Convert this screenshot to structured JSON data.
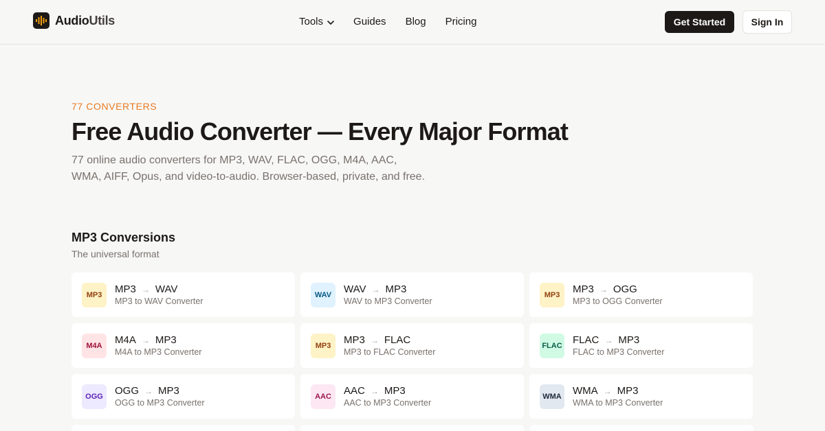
{
  "nav": {
    "logo_primary": "Audio",
    "logo_secondary": "Utils",
    "menu": [
      "Tools",
      "Guides",
      "Blog",
      "Pricing"
    ],
    "get_started": "Get Started",
    "sign_in": "Sign In"
  },
  "hero": {
    "eyebrow": "77 CONVERTERS",
    "title": "Free Audio Converter — Every Major Format",
    "lede": "77 online audio converters for MP3, WAV, FLAC, OGG, M4A, AAC, WMA, AIFF, Opus, and video-to-audio. Browser-based, private, and free."
  },
  "section": {
    "title": "MP3 Conversions",
    "subtitle": "The universal format"
  },
  "colors": {
    "accent": "#ea7a22",
    "dark": "#1c1917"
  },
  "cards": [
    {
      "badge": "MP3",
      "from": "MP3",
      "to": "WAV",
      "sub": "MP3 to WAV Converter",
      "bg": "#fef3c7",
      "fg": "#92400e"
    },
    {
      "badge": "WAV",
      "from": "WAV",
      "to": "MP3",
      "sub": "WAV to MP3 Converter",
      "bg": "#e0f2fe",
      "fg": "#075985"
    },
    {
      "badge": "MP3",
      "from": "MP3",
      "to": "OGG",
      "sub": "MP3 to OGG Converter",
      "bg": "#fef3c7",
      "fg": "#92400e"
    },
    {
      "badge": "M4A",
      "from": "M4A",
      "to": "MP3",
      "sub": "M4A to MP3 Converter",
      "bg": "#ffe4e6",
      "fg": "#9f1239"
    },
    {
      "badge": "MP3",
      "from": "MP3",
      "to": "FLAC",
      "sub": "MP3 to FLAC Converter",
      "bg": "#fef3c7",
      "fg": "#92400e"
    },
    {
      "badge": "FLAC",
      "from": "FLAC",
      "to": "MP3",
      "sub": "FLAC to MP3 Converter",
      "bg": "#d1fae5",
      "fg": "#065f46"
    },
    {
      "badge": "OGG",
      "from": "OGG",
      "to": "MP3",
      "sub": "OGG to MP3 Converter",
      "bg": "#ede9fe",
      "fg": "#5b21b6"
    },
    {
      "badge": "AAC",
      "from": "AAC",
      "to": "MP3",
      "sub": "AAC to MP3 Converter",
      "bg": "#fce7f3",
      "fg": "#9d174d"
    },
    {
      "badge": "WMA",
      "from": "WMA",
      "to": "MP3",
      "sub": "WMA to MP3 Converter",
      "bg": "#e2e8f0",
      "fg": "#1e293b"
    }
  ]
}
